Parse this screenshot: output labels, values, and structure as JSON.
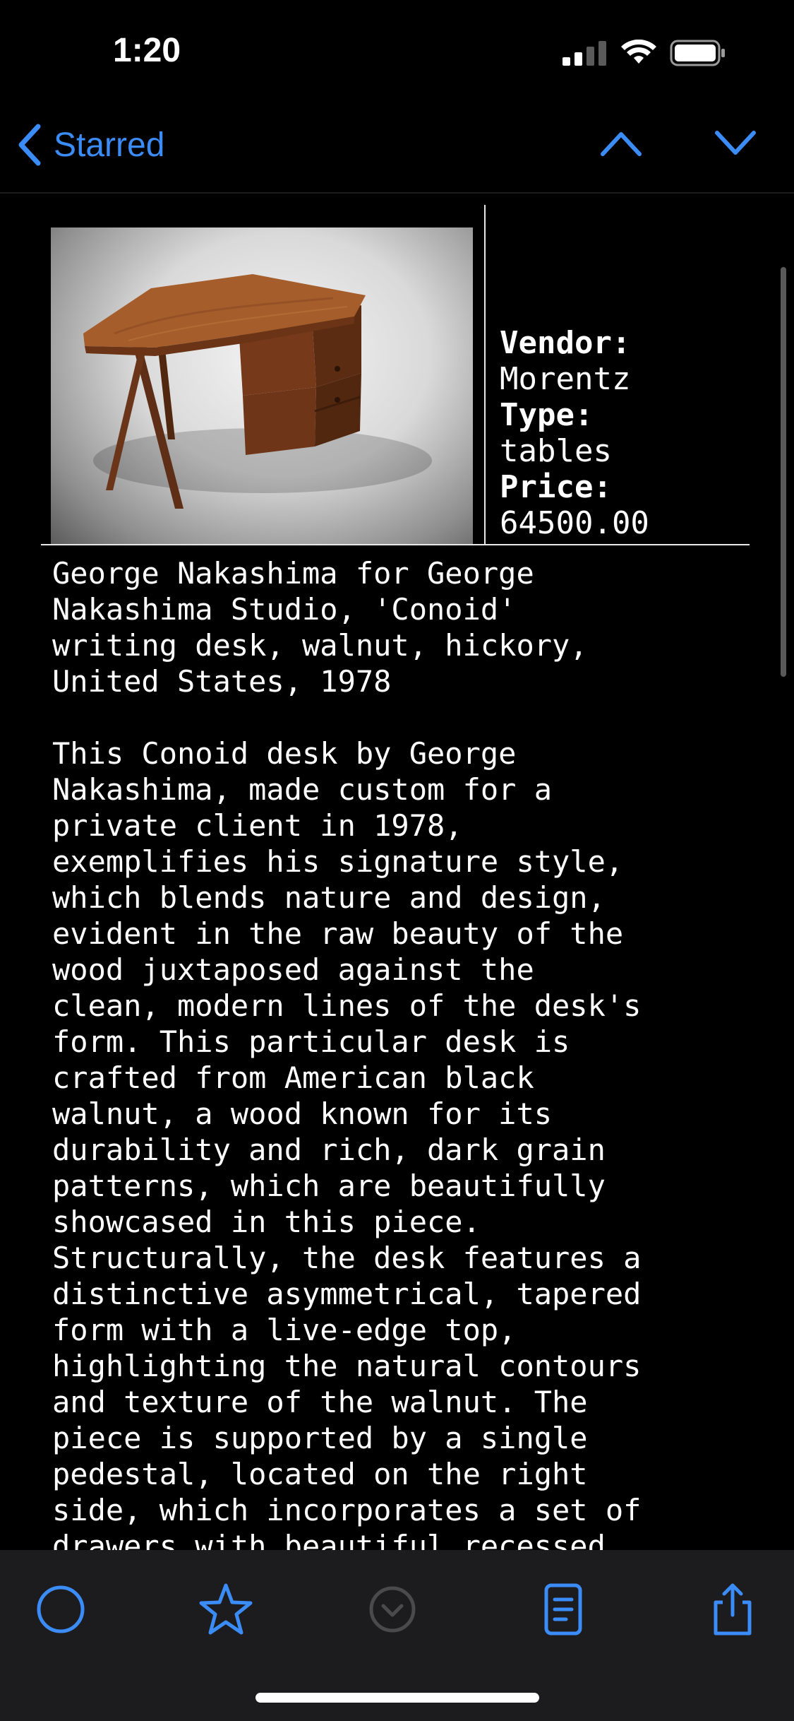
{
  "status_bar": {
    "time": "1:20"
  },
  "nav": {
    "back_label": "Starred",
    "accent_color": "#3b8cf7"
  },
  "product": {
    "vendor_label": "Vendor:",
    "vendor": "Morentz",
    "type_label": "Type:",
    "type": "tables",
    "price_label": "Price:",
    "price": "64500.00",
    "image_icon": "walnut-desk-photo"
  },
  "description": {
    "title_lines": [
      "George Nakashima for George",
      "Nakashima Studio, 'Conoid'",
      "writing desk, walnut, hickory,",
      "United States, 1978"
    ],
    "body_lines": [
      "This Conoid desk by George",
      "Nakashima, made custom for a",
      "private client in 1978,",
      "exemplifies his signature style,",
      "which blends nature and design,",
      "evident in the raw beauty of the",
      "wood juxtaposed against the",
      "clean, modern lines of the desk's",
      "form. This particular desk is",
      "crafted from American black",
      "walnut, a wood known for its",
      "durability and rich, dark grain",
      "patterns, which are beautifully",
      "showcased in this piece.",
      "Structurally, the desk features a",
      "distinctive asymmetrical, tapered",
      "form with a live-edge top,",
      "highlighting the natural contours",
      "and texture of the walnut. The",
      "piece is supported by a single",
      "pedestal, located on the right",
      "side, which incorporates a set of",
      "drawers with beautiful recessed"
    ]
  },
  "toolbar": {
    "buttons": [
      "circle-icon",
      "star-icon",
      "chevron-down-circle-icon",
      "document-icon",
      "share-icon"
    ]
  }
}
